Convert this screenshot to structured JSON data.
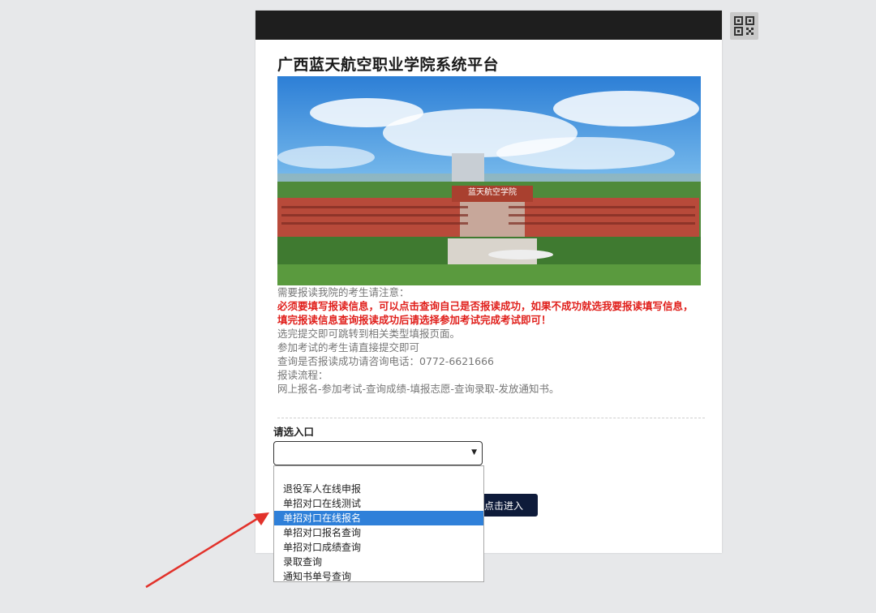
{
  "page": {
    "title": "广西蓝天航空职业学院系统平台"
  },
  "banner": {
    "sign_text": "蓝天航空学院"
  },
  "notice": {
    "lines": [
      "需要报读我院的考生请注意：",
      "必须要填写报读信息，可以点击查询自己是否报读成功，如果不成功就选我要报读填写信息，",
      "填完报读信息查询报读成功后请选择参加考试完成考试即可！",
      "选完提交即可跳转到相关类型填报页面。",
      "参加考试的考生请直接提交即可",
      "查询是否报读成功请咨询电话：0772-6621666",
      "报读流程：",
      "网上报名-参加考试-查询成绩-填报志愿-查询录取-发放通知书。"
    ]
  },
  "form": {
    "select_label": "请选入口",
    "select_value": "",
    "enter_button": "点击进入",
    "options": [
      "",
      "退役军人在线申报",
      "单招对口在线测试",
      "单招对口在线报名",
      "单招对口报名查询",
      "单招对口成绩查询",
      "录取查询",
      "通知书单号查询"
    ],
    "highlighted_option": "单招对口在线报名"
  },
  "colors": {
    "accent": "#2f80d9",
    "warning": "#e0201c",
    "button": "#0e1b3a",
    "arrow": "#e2322b"
  },
  "icons": {
    "qr": "qr-code-icon",
    "caret": "dropdown-caret-icon",
    "arrow": "red-annotation-arrow"
  }
}
